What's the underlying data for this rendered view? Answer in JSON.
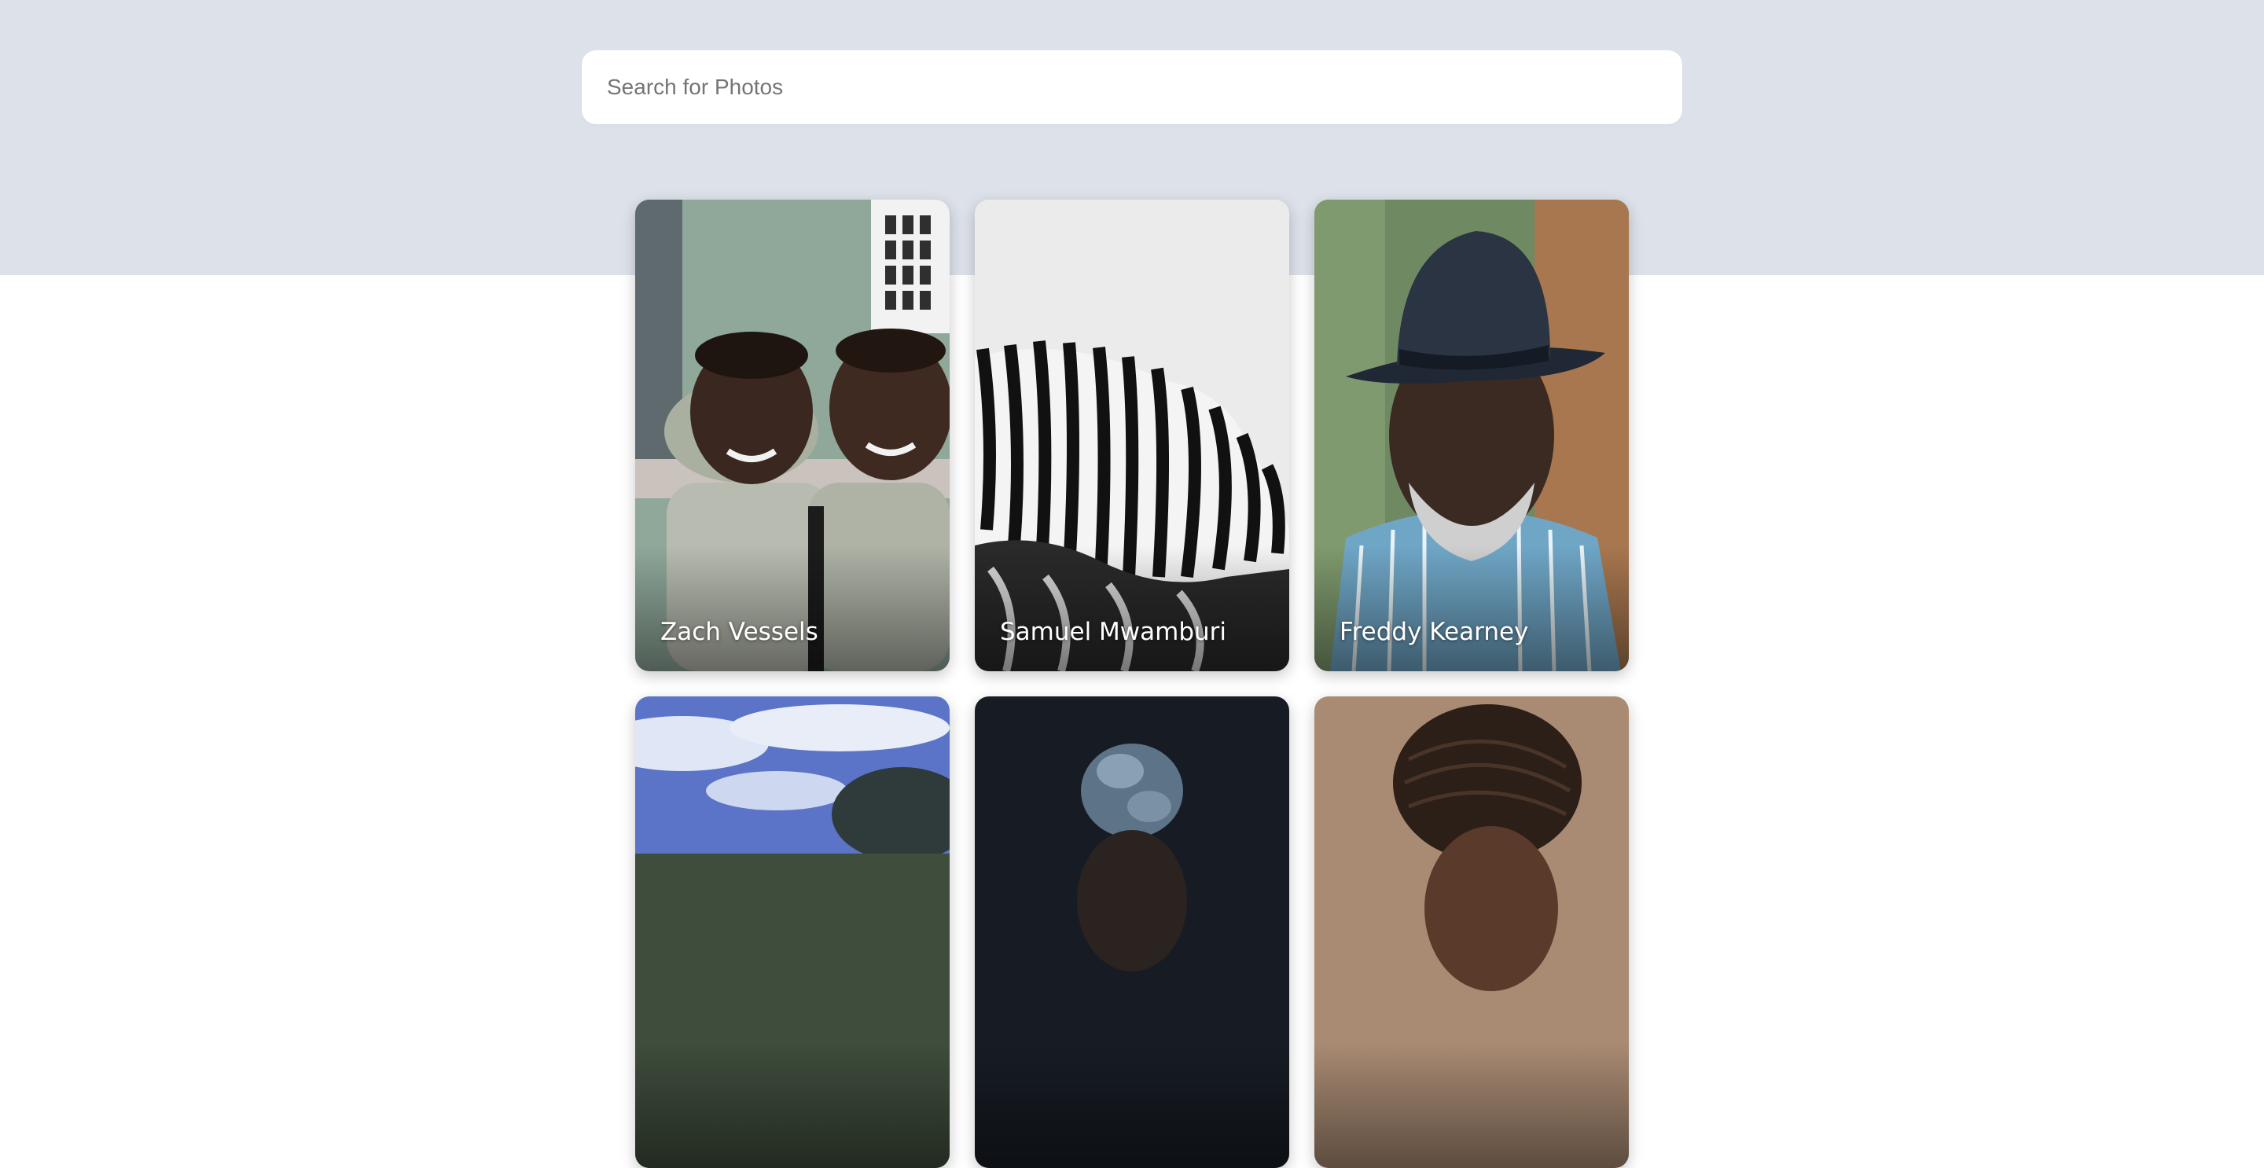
{
  "search": {
    "placeholder": "Search for Photos"
  },
  "photos": [
    {
      "photographer": "Zach Vessels",
      "subject": "two-boys-photo"
    },
    {
      "photographer": "Samuel Mwamburi",
      "subject": "zebra-photo"
    },
    {
      "photographer": "Freddy Kearney",
      "subject": "old-man-hat-photo"
    },
    {
      "photographer": "",
      "subject": "sky-tree-photo"
    },
    {
      "photographer": "",
      "subject": "headwrap-photo"
    },
    {
      "photographer": "",
      "subject": "braided-hair-photo"
    }
  ],
  "colors": {
    "hero_background": "#dde1e9",
    "page_background": "#ffffff",
    "caption_text": "#ffffff"
  }
}
